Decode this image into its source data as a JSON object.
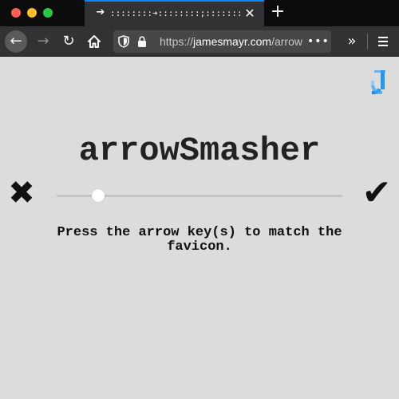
{
  "browser": {
    "tab": {
      "favicon": "right-arrow-icon",
      "title": "::::::::➔::::::::;::::::::::",
      "close_icon": "close-icon"
    },
    "new_tab_icon": "plus-icon",
    "toolbar": {
      "back_icon": "back-arrow-icon",
      "forward_icon": "forward-arrow-icon",
      "reload_icon": "reload-icon",
      "home_icon": "home-icon",
      "url_scheme": "https://",
      "url_host": "jamesmayr.com",
      "url_path": "/arrow",
      "url_more_icon": "more-dots-icon",
      "overflow_icon": "double-chevron-icon",
      "menu_icon": "hamburger-menu-icon"
    }
  },
  "page": {
    "title": "arrowSmasher",
    "instructions": "Press the arrow key(s) to match the favicon.",
    "fail_icon": "heavy-x-icon",
    "success_icon": "heavy-check-icon",
    "progress_fraction": 0.146,
    "logo_icon": "jm-logo-icon"
  },
  "colors": {
    "page_background": "#dcdcdc",
    "logo_blue": "#2196f3",
    "tab_highlight": "#0a84ff"
  }
}
